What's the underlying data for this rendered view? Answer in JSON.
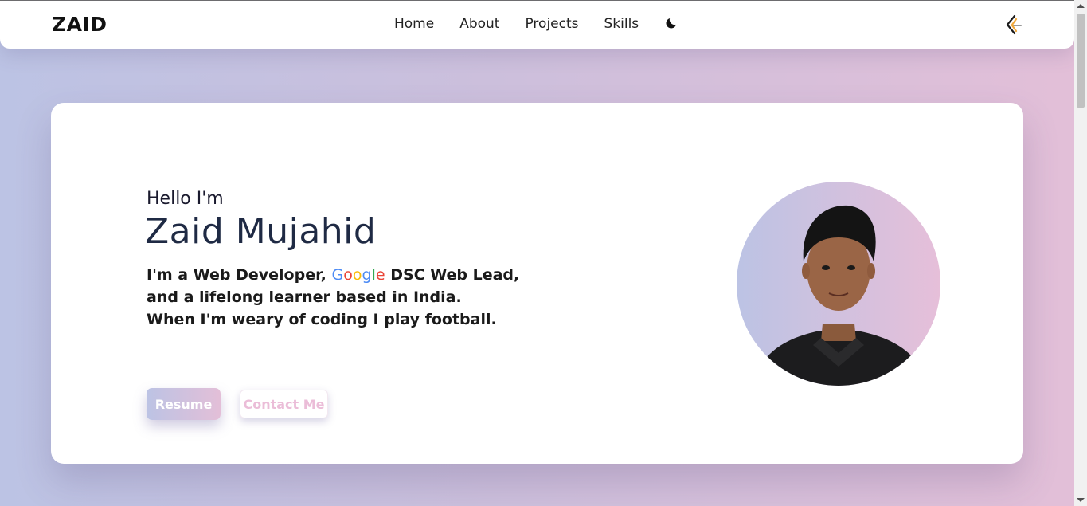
{
  "nav": {
    "brand": "ZAID",
    "links": [
      "Home",
      "About",
      "Projects",
      "Skills"
    ],
    "theme_toggle_icon": "moon-icon",
    "logo_icon": "code-logo-icon"
  },
  "hero": {
    "greeting": "Hello I'm",
    "name": "Zaid Mujahid",
    "bio_line1_pre": "I'm a Web Developer,",
    "google_letters": [
      "G",
      "o",
      "o",
      "g",
      "l",
      "e"
    ],
    "bio_line1_post": "DSC Web Lead,",
    "bio_line2": "and a lifelong learner based in India.",
    "bio_line3": "When I'm weary of coding I play football.",
    "resume_label": "Resume",
    "contact_label": "Contact Me"
  },
  "colors": {
    "gradient_start": "#bcc3e4",
    "gradient_end": "#e3bfd8",
    "heading": "#1f2a44",
    "google_blue": "#4c8bf5",
    "google_red": "#ea4335",
    "google_yellow": "#fbbc05",
    "google_green": "#34a853"
  }
}
